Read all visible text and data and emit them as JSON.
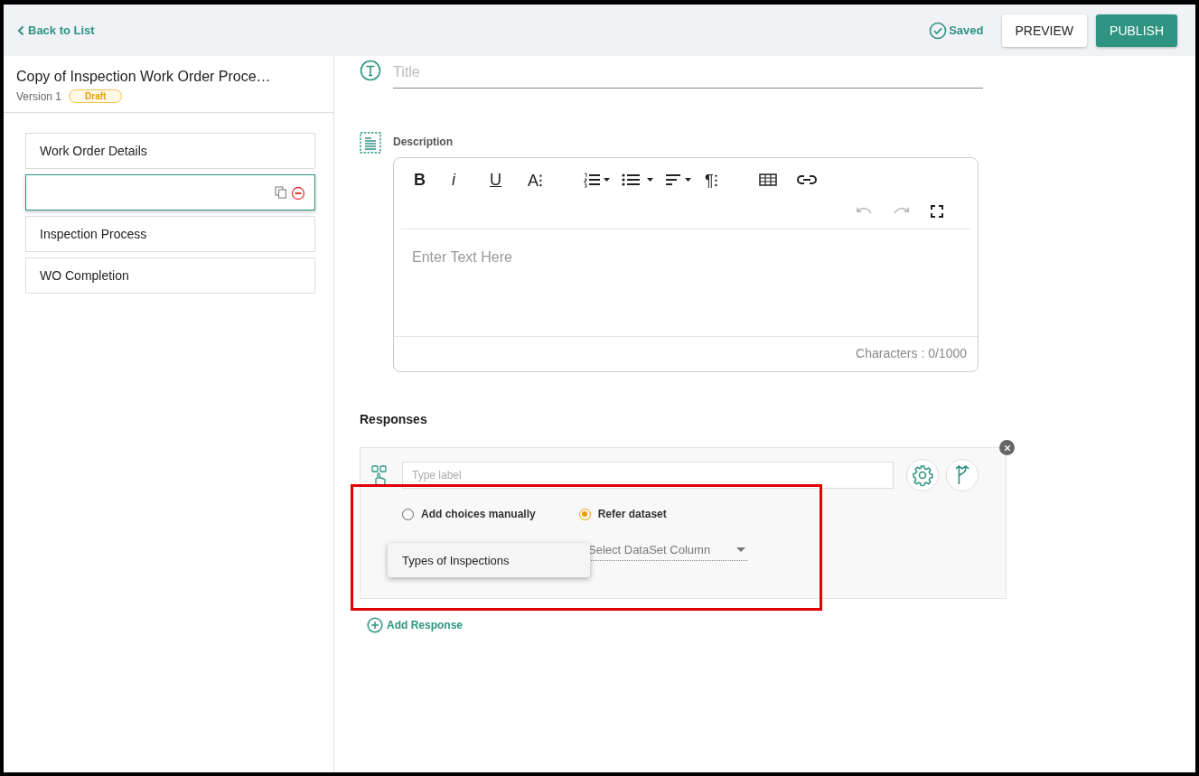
{
  "header": {
    "back_link": "Back to List",
    "status": "Saved",
    "buttons": [
      "PREVIEW",
      "PUBLISH"
    ]
  },
  "sidebar": {
    "title": "Copy of Inspection Work Order Proce…",
    "version": "Version 1",
    "badge": "Draft",
    "items": [
      {
        "label": "Work Order Details",
        "selected": false
      },
      {
        "selected": true
      },
      {
        "label": "Inspection Process",
        "selected": false
      },
      {
        "label": "WO Completion",
        "selected": false
      }
    ]
  },
  "title_field": {
    "placeholder": "Title"
  },
  "description": {
    "label": "Description",
    "format_buttons": [
      "B",
      "i",
      "U",
      "A⁝"
    ],
    "paragraph_button": "¶⁝",
    "undo_disabled": true,
    "redo_disabled": true,
    "placeholder": "Enter Text Here",
    "counter": "Characters : 0/1000"
  },
  "responses": {
    "heading": "Responses",
    "label_field": {
      "placeholder": "Type label"
    },
    "options": [
      {
        "label": "Add choices manually",
        "selected": false
      },
      {
        "label": "Refer dataset",
        "selected": true
      }
    ],
    "dataset_menu": [
      "Types of Inspections"
    ],
    "column_select": {
      "placeholder": "Select DataSet Column"
    },
    "add_link": "Add Response"
  }
}
